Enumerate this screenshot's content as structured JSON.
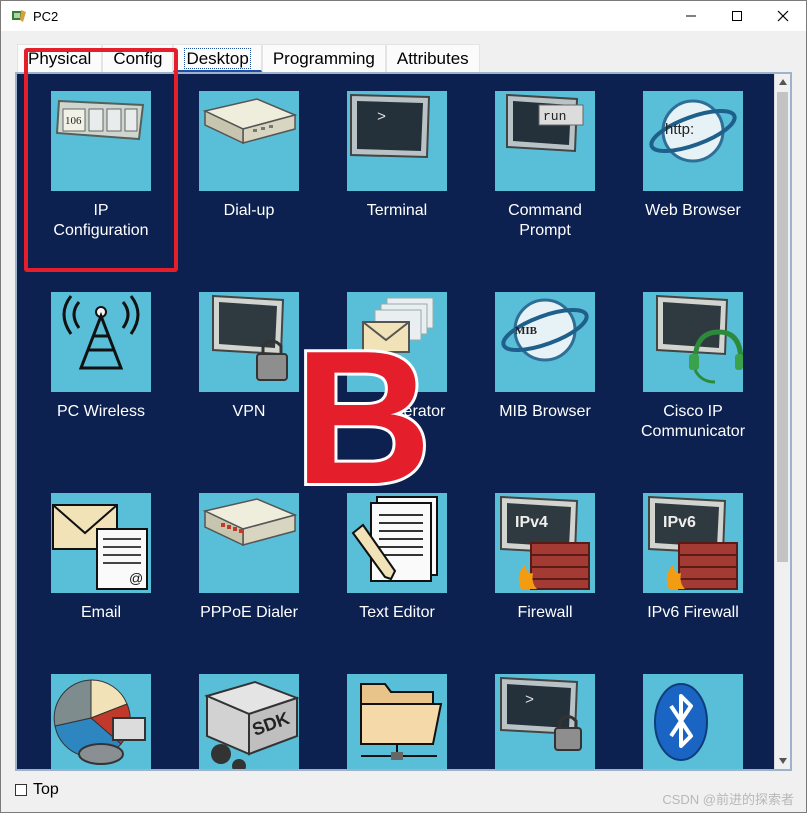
{
  "window": {
    "title": "PC2",
    "controls": [
      "minimize-icon",
      "maximize-icon",
      "close-icon"
    ]
  },
  "tabs": [
    {
      "label": "Physical",
      "active": false
    },
    {
      "label": "Config",
      "active": false
    },
    {
      "label": "Desktop",
      "active": true
    },
    {
      "label": "Programming",
      "active": false
    },
    {
      "label": "Attributes",
      "active": false
    }
  ],
  "apps": [
    {
      "label": "IP\nConfiguration",
      "icon": "ip-configuration-icon"
    },
    {
      "label": "Dial-up",
      "icon": "modem-icon"
    },
    {
      "label": "Terminal",
      "icon": "terminal-icon"
    },
    {
      "label": "Command\nPrompt",
      "icon": "command-prompt-icon"
    },
    {
      "label": "Web Browser",
      "icon": "web-browser-icon"
    },
    {
      "label": "PC Wireless",
      "icon": "wireless-antenna-icon"
    },
    {
      "label": "VPN",
      "icon": "vpn-icon"
    },
    {
      "label": "nerator",
      "icon": "traffic-generator-icon"
    },
    {
      "label": "MIB Browser",
      "icon": "mib-browser-icon"
    },
    {
      "label": "Cisco IP\nCommunicator",
      "icon": "ip-communicator-icon"
    },
    {
      "label": "Email",
      "icon": "email-icon"
    },
    {
      "label": "PPPoE Dialer",
      "icon": "pppoe-dialer-icon"
    },
    {
      "label": "Text Editor",
      "icon": "text-editor-icon"
    },
    {
      "label": "Firewall",
      "icon": "firewall-icon"
    },
    {
      "label": "IPv6 Firewall",
      "icon": "ipv6-firewall-icon"
    },
    {
      "label": "",
      "icon": "netflow-collector-icon"
    },
    {
      "label": "",
      "icon": "sdk-icon"
    },
    {
      "label": "",
      "icon": "file-manager-icon"
    },
    {
      "label": "",
      "icon": "ssh-terminal-icon"
    },
    {
      "label": "",
      "icon": "bluetooth-icon"
    }
  ],
  "tile_text": {
    "ip": "106",
    "run": "run",
    "http": "http:",
    "mib": "MIB",
    "ipv4": "IPv4",
    "ipv6": "IPv6",
    "sdk": "SDK",
    "at": "@",
    "prompt": ">"
  },
  "annotation": {
    "letter": "B",
    "color": "#e51e2b"
  },
  "footer": {
    "top_label": "Top",
    "top_checked": false,
    "watermark": "CSDN @前进的探索者"
  },
  "colors": {
    "desktop_bg": "#0d2150",
    "tile_bg": "#59bfd8",
    "highlight": "#e51e2b"
  }
}
